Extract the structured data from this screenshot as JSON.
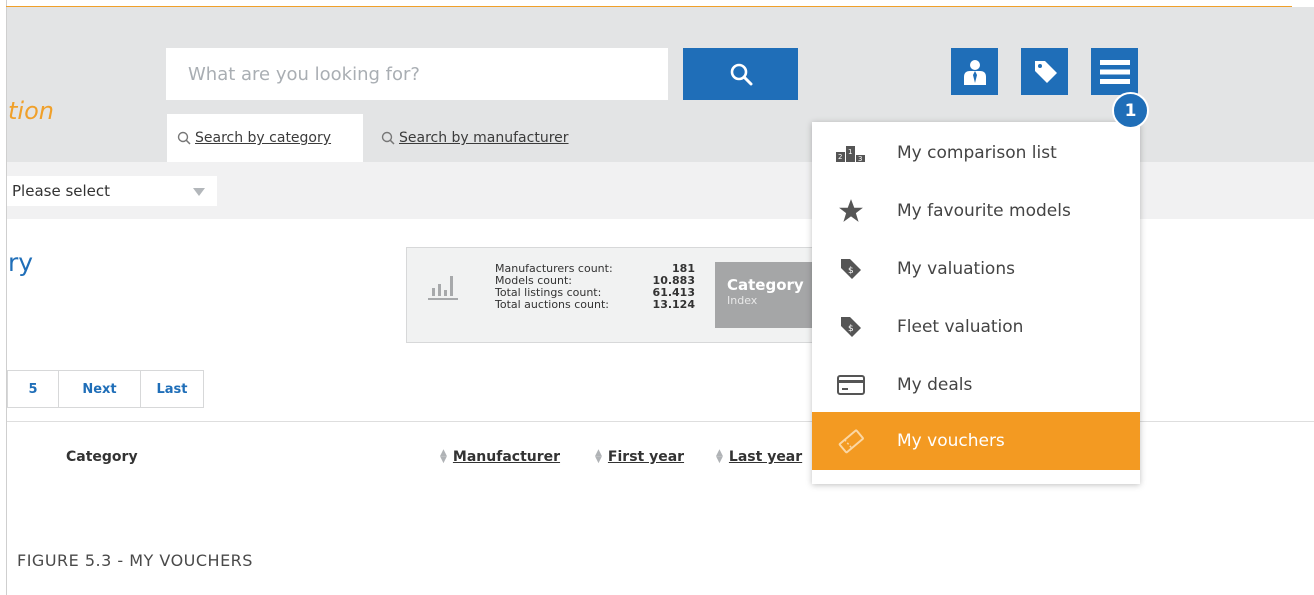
{
  "header": {
    "brand_fragment": "tion",
    "search": {
      "placeholder": "What are you looking for?"
    },
    "icons": [
      "search-icon",
      "user-icon",
      "tag-icon",
      "hamburger-menu-icon"
    ],
    "tabs": [
      {
        "label": "Search by category",
        "active": true
      },
      {
        "label": "Search by manufacturer",
        "active": false
      }
    ]
  },
  "filter": {
    "select_value": "Please select"
  },
  "page": {
    "heading": "ry"
  },
  "stats": {
    "rows": [
      {
        "label": "Manufacturers count:",
        "value": "181"
      },
      {
        "label": "Models count:",
        "value": "10.883"
      },
      {
        "label": "Total listings count:",
        "value": "61.413"
      },
      {
        "label": "Total auctions count:",
        "value": "13.124"
      }
    ],
    "category_box": {
      "title": "Category",
      "subtitle": "Index"
    }
  },
  "pagination": {
    "items": [
      "5",
      "Next",
      "Last"
    ]
  },
  "table": {
    "columns": {
      "category": "Category",
      "manufacturer": "Manufacturer",
      "first_year": "First year",
      "last_year": "Last year"
    }
  },
  "menu": {
    "badge": "1",
    "items": [
      {
        "label": "My comparison list",
        "icon": "podium-icon",
        "active": false
      },
      {
        "label": "My favourite models",
        "icon": "star-icon",
        "active": false
      },
      {
        "label": "My valuations",
        "icon": "price-tag-icon",
        "active": false
      },
      {
        "label": "Fleet valuation",
        "icon": "price-tag-icon",
        "active": false
      },
      {
        "label": "My deals",
        "icon": "card-icon",
        "active": false
      },
      {
        "label": "My vouchers",
        "icon": "voucher-icon",
        "active": true
      }
    ]
  },
  "colors": {
    "brand_blue": "#1f6eb8",
    "accent_orange": "#f39a22",
    "header_gray": "#e3e4e5"
  },
  "caption": "FIGURE 5.3 - MY VOUCHERS"
}
